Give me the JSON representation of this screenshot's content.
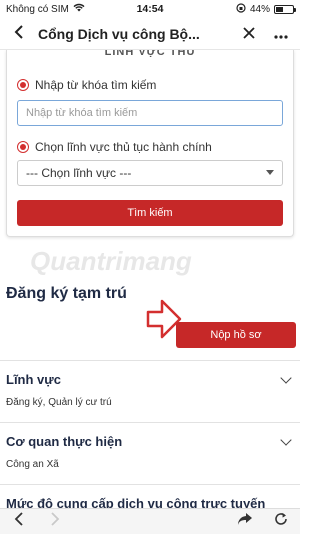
{
  "status_bar": {
    "carrier": "Không có SIM",
    "time": "14:54",
    "battery": "44%",
    "battery_level": 0.44
  },
  "nav": {
    "title": "Cổng Dịch vụ công Bộ...",
    "back_icon": "chevron-left-icon",
    "close_icon": "close-icon",
    "more_icon": "more-icon"
  },
  "search_card": {
    "title": "LĨNH VỰC THỦ",
    "option_keyword_label": "Nhập từ khóa tìm kiếm",
    "search_placeholder": "Nhập từ khóa tìm kiếm",
    "option_field_label": "Chọn lĩnh vực thủ tục hành chính",
    "select_value": "--- Chọn lĩnh vực ---",
    "search_button": "Tìm kiếm"
  },
  "procedure": {
    "heading": "Đăng ký tạm trú",
    "submit_button": "Nộp hồ sơ"
  },
  "details": [
    {
      "title": "Lĩnh vực",
      "value": "Đăng ký, Quản lý cư trú"
    },
    {
      "title": "Cơ quan thực hiện",
      "value": "Công an Xã"
    },
    {
      "title": "Mức độ cung cấp dịch vụ công trực tuyến",
      "value": ""
    }
  ],
  "watermark": "Quantrimang",
  "accent_color": "#c62828"
}
